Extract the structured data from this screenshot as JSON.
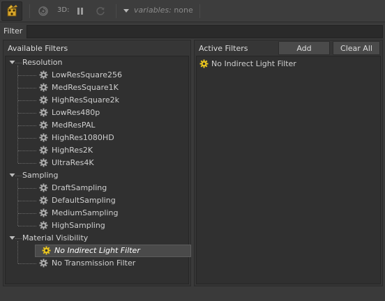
{
  "toolbar": {
    "label_3d": "3D:",
    "variables_label": "variables:",
    "variables_value": "none",
    "icons": [
      "camera-film-icon",
      "swirl-icon",
      "pause-icon",
      "refresh-icon",
      "dropdown-arrow-icon"
    ]
  },
  "filter": {
    "label": "Filter",
    "value": ""
  },
  "available": {
    "title": "Available Filters",
    "categories": [
      {
        "name": "Resolution",
        "items": [
          "LowResSquare256",
          "MedResSquare1K",
          "HighResSquare2k",
          "LowRes480p",
          "MedResPAL",
          "HighRes1080HD",
          "HighRes2K",
          "UltraRes4K"
        ]
      },
      {
        "name": "Sampling",
        "items": [
          "DraftSampling",
          "DefaultSampling",
          "MediumSampling",
          "HighSampling"
        ]
      },
      {
        "name": "Material Visibility",
        "items": [
          "No Indirect Light Filter",
          "No Transmission Filter"
        ]
      }
    ],
    "selected": "No Indirect Light Filter"
  },
  "active": {
    "title": "Active Filters",
    "add_label": "Add",
    "clear_label": "Clear All",
    "items": [
      "No Indirect Light Filter"
    ]
  },
  "colors": {
    "gear_active": "#e7c31f",
    "gear_inactive": "#a8a8a8"
  }
}
